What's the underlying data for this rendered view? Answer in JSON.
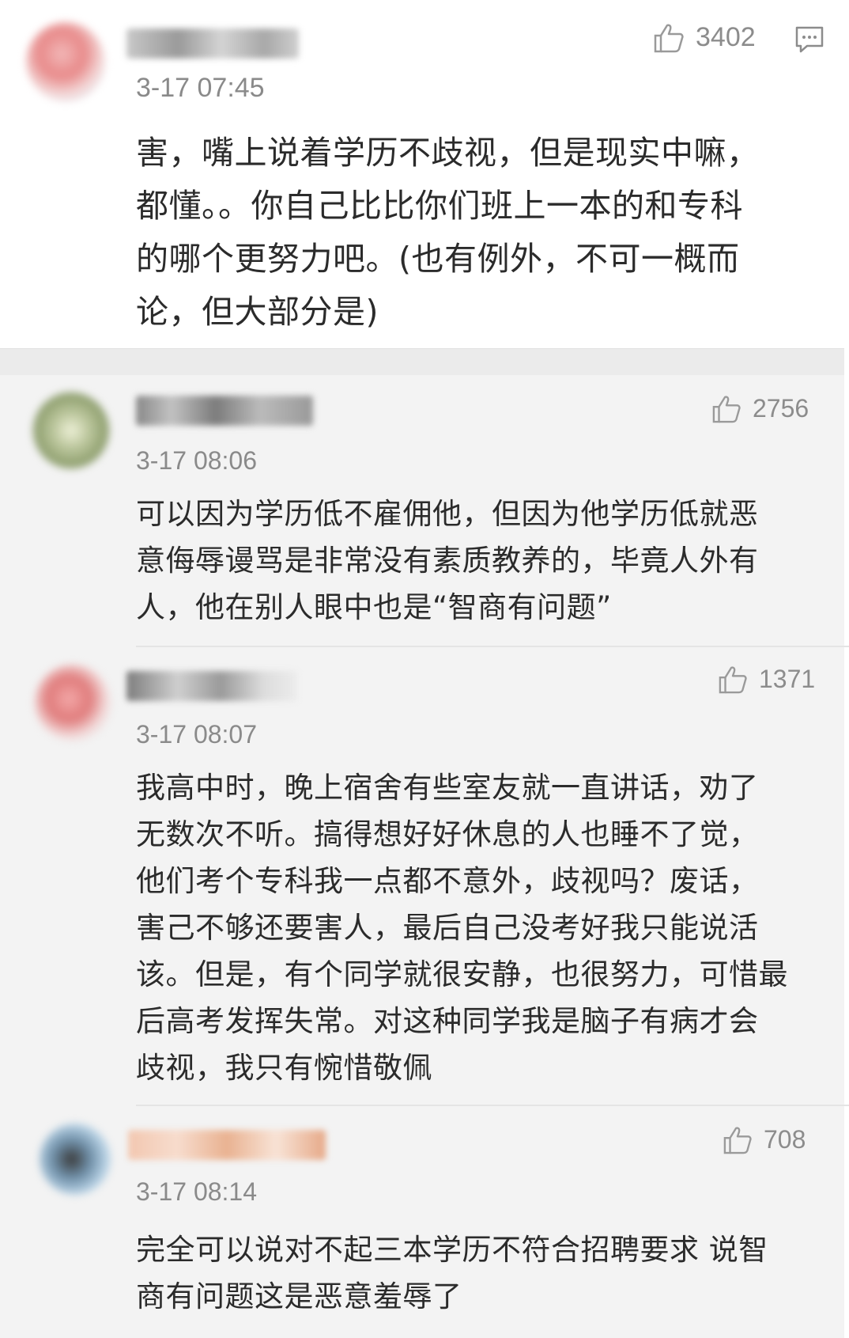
{
  "comments": [
    {
      "time": "3-17 07:45",
      "likes": "3402",
      "lines": [
        "害，嘴上说着学历不歧视，但是现实中嘛，",
        "都懂。。你自己比比你们班上一本的和专科",
        "的哪个更努力吧。(也有例外，不可一概而",
        "论，但大部分是)"
      ]
    },
    {
      "time": "3-17 08:06",
      "likes": "2756",
      "lines": [
        "可以因为学历低不雇佣他，但因为他学历低就恶",
        "意侮辱谩骂是非常没有素质教养的，毕竟人外有",
        "人，他在别人眼中也是“智商有问题”"
      ]
    },
    {
      "time": "3-17 08:07",
      "likes": "1371",
      "lines": [
        "我高中时，晚上宿舍有些室友就一直讲话，劝了",
        "无数次不听。搞得想好好休息的人也睡不了觉，",
        "他们考个专科我一点都不意外，歧视吗？废话，",
        "害己不够还要害人，最后自己没考好我只能说活",
        "该。但是，有个同学就很安静，也很努力，可惜最",
        "后高考发挥失常。对这种同学我是脑子有病才会",
        "歧视，我只有惋惜敬佩"
      ]
    },
    {
      "time": "3-17 08:14",
      "likes": "708",
      "lines": [
        "完全可以说对不起三本学历不符合招聘要求 说智",
        "商有问题这是恶意羞辱了"
      ]
    }
  ],
  "icons": {
    "like": "thumbs-up-icon",
    "reply": "comment-icon"
  },
  "colors": {
    "text": "#2b2b2b",
    "meta": "#8a8a8a",
    "background": "#f3f3f3",
    "top_card": "#ffffff"
  }
}
